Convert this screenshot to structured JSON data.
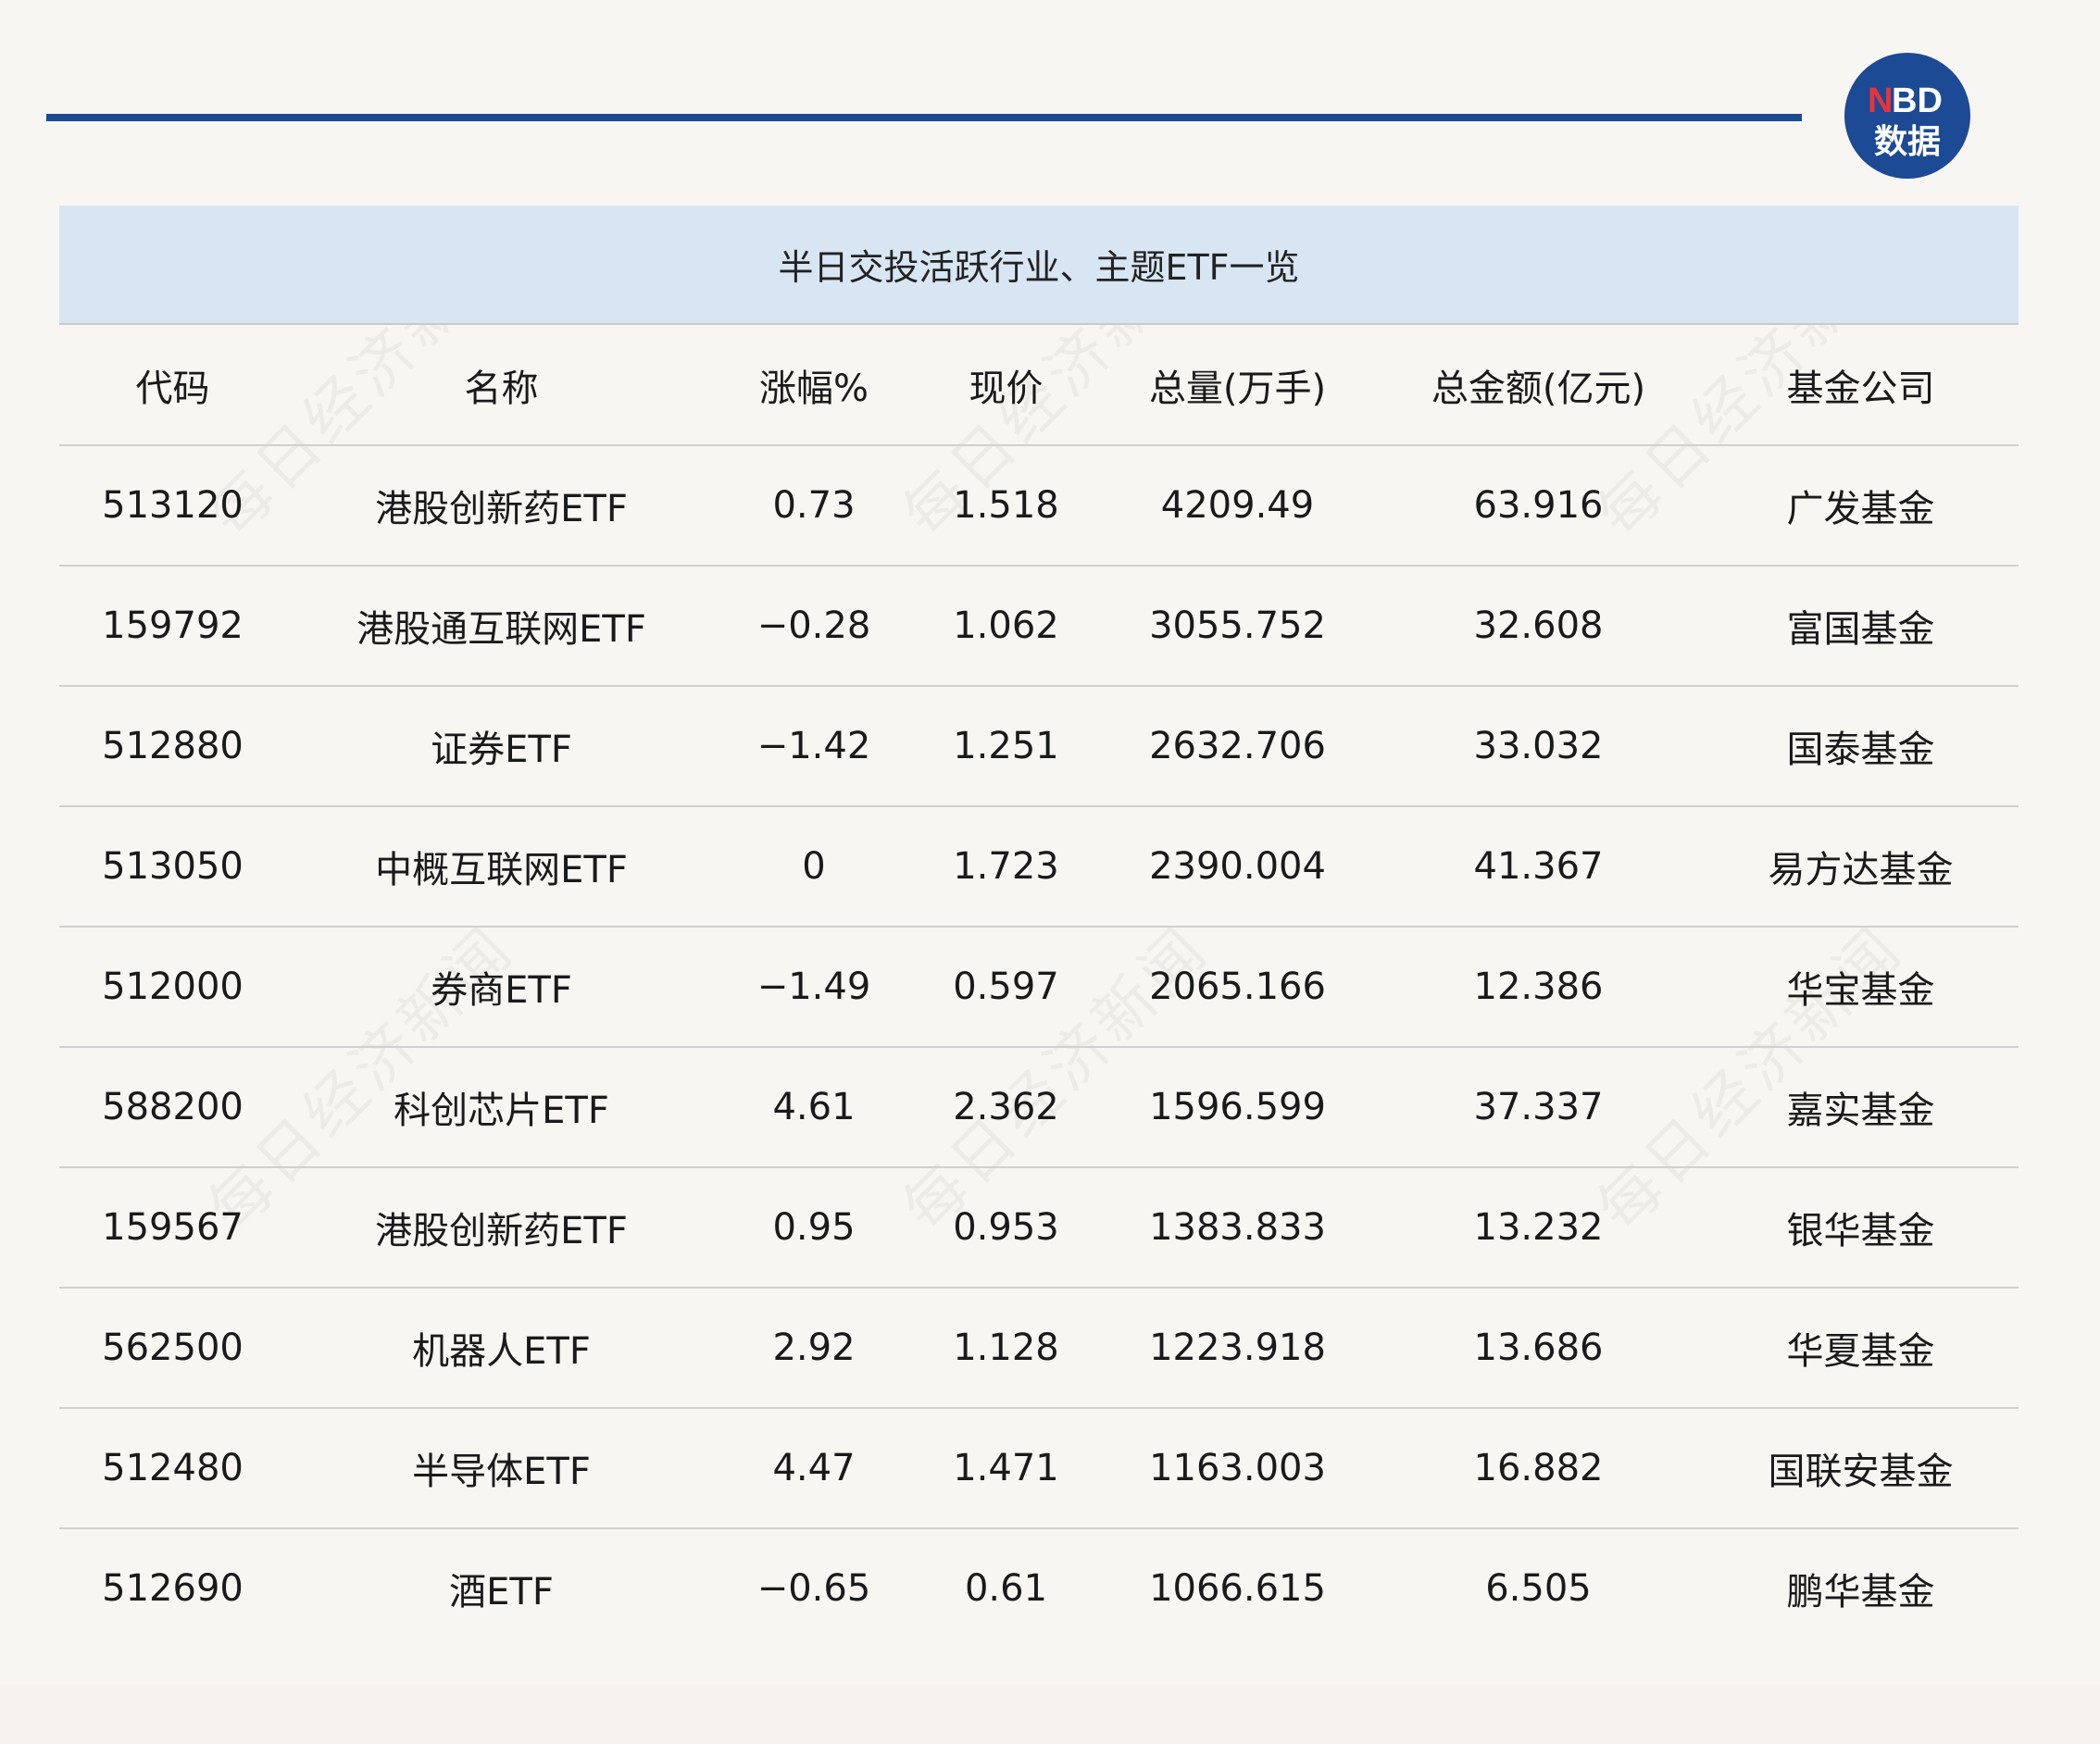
{
  "title": "半日交投活跃行业、主题ETF一览",
  "logo": {
    "top": "NBD",
    "bottom": "数据",
    "accent": "#e8333c",
    "bg": "#1d4a94"
  },
  "watermark": "每日经济新闻",
  "colors": {
    "rule": "#1d4a94",
    "title_bg": "#d8e6f3",
    "page_bg": "#f8f6f2"
  },
  "columns": [
    "代码",
    "名称",
    "涨幅%",
    "现价",
    "总量(万手)",
    "总金额(亿元)",
    "基金公司"
  ],
  "rows": [
    [
      "513120",
      "港股创新药ETF",
      "0.73",
      "1.518",
      "4209.49",
      "63.916",
      "广发基金"
    ],
    [
      "159792",
      "港股通互联网ETF",
      "−0.28",
      "1.062",
      "3055.752",
      "32.608",
      "富国基金"
    ],
    [
      "512880",
      "证券ETF",
      "−1.42",
      "1.251",
      "2632.706",
      "33.032",
      "国泰基金"
    ],
    [
      "513050",
      "中概互联网ETF",
      "0",
      "1.723",
      "2390.004",
      "41.367",
      "易方达基金"
    ],
    [
      "512000",
      "券商ETF",
      "−1.49",
      "0.597",
      "2065.166",
      "12.386",
      "华宝基金"
    ],
    [
      "588200",
      "科创芯片ETF",
      "4.61",
      "2.362",
      "1596.599",
      "37.337",
      "嘉实基金"
    ],
    [
      "159567",
      "港股创新药ETF",
      "0.95",
      "0.953",
      "1383.833",
      "13.232",
      "银华基金"
    ],
    [
      "562500",
      "机器人ETF",
      "2.92",
      "1.128",
      "1223.918",
      "13.686",
      "华夏基金"
    ],
    [
      "512480",
      "半导体ETF",
      "4.47",
      "1.471",
      "1163.003",
      "16.882",
      "国联安基金"
    ],
    [
      "512690",
      "酒ETF",
      "−0.65",
      "0.61",
      "1066.615",
      "6.505",
      "鹏华基金"
    ]
  ]
}
